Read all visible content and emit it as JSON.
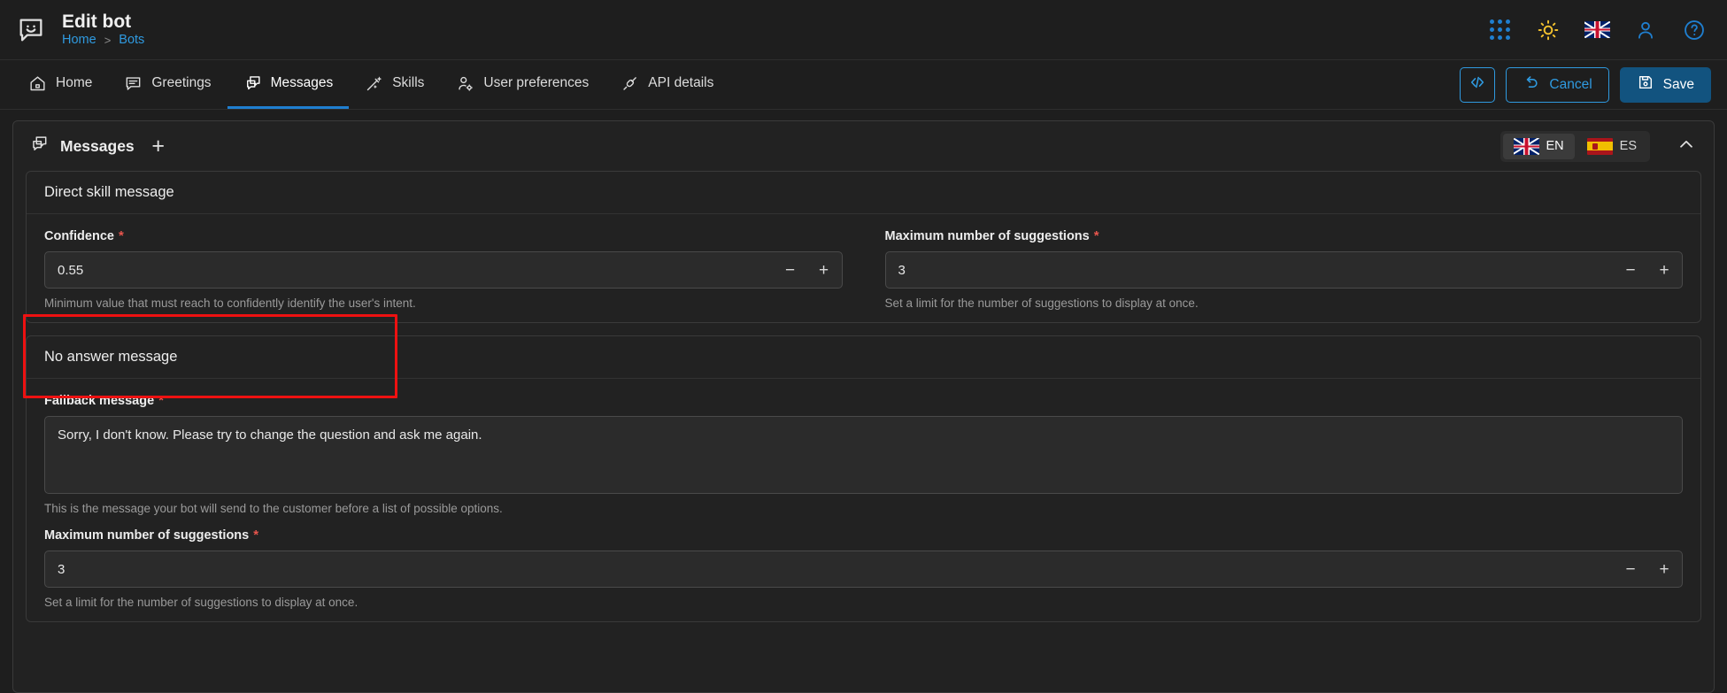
{
  "header": {
    "logo_icon": "chat-bubble-smiley-icon",
    "title": "Edit bot",
    "breadcrumb": {
      "home": "Home",
      "separator": ">",
      "current": "Bots"
    },
    "icons": [
      {
        "name": "apps-grid-icon",
        "label": "Apps"
      },
      {
        "name": "sun-theme-icon",
        "label": "Theme"
      },
      {
        "name": "uk-flag-icon",
        "label": "Language"
      },
      {
        "name": "user-account-icon",
        "label": "Account"
      },
      {
        "name": "help-question-icon",
        "label": "Help"
      }
    ],
    "accent_blue": "#1f7fd0",
    "link_blue": "#2f9ae0",
    "sun_yellow": "#f2c12e"
  },
  "nav": {
    "tabs": [
      {
        "label": "Home",
        "icon": "home-icon",
        "active": false
      },
      {
        "label": "Greetings",
        "icon": "speech-bubble-icon",
        "active": false
      },
      {
        "label": "Messages",
        "icon": "double-speech-bubble-icon",
        "active": true
      },
      {
        "label": "Skills",
        "icon": "magic-wand-icon",
        "active": false
      },
      {
        "label": "User preferences",
        "icon": "user-gear-icon",
        "active": false
      },
      {
        "label": "API details",
        "icon": "plug-connector-icon",
        "active": false
      }
    ],
    "actions": {
      "code_icon": "code-brackets-icon",
      "cancel_label": "Cancel",
      "cancel_icon": "undo-arrow-icon",
      "save_label": "Save",
      "save_icon": "floppy-disk-icon"
    }
  },
  "panel": {
    "title": "Messages",
    "title_icon": "double-speech-bubble-icon",
    "add_label": "+",
    "collapse_icon": "chevron-up-icon",
    "languages": [
      {
        "code": "EN",
        "flag": "uk-flag-icon",
        "selected": true
      },
      {
        "code": "ES",
        "flag": "spain-flag-icon",
        "selected": false
      }
    ]
  },
  "cards": [
    {
      "title": "Direct skill message",
      "fields": [
        {
          "label": "Confidence",
          "required": true,
          "value": "0.55",
          "helper": "Minimum value that must reach to confidently identify the user's intent.",
          "stepper": {
            "minus": "−",
            "plus": "+"
          },
          "highlighted": true
        },
        {
          "label": "Maximum number of suggestions",
          "required": true,
          "value": "3",
          "helper": "Set a limit for the number of suggestions to display at once.",
          "stepper": {
            "minus": "−",
            "plus": "+"
          },
          "highlighted": false
        }
      ]
    },
    {
      "title": "No answer message",
      "fields": [
        {
          "label": "Fallback message",
          "required": true,
          "value": "Sorry, I don't know. Please try to change the question and ask me again.",
          "helper": "This is the message your bot will send to the customer before a list of possible options."
        },
        {
          "label": "Maximum number of suggestions",
          "required": true,
          "value": "3",
          "helper": "Set a limit for the number of suggestions to display at once.",
          "stepper": {
            "minus": "−",
            "plus": "+"
          }
        }
      ]
    }
  ],
  "colors": {
    "background": "#1e1e1e",
    "panel": "#222222",
    "border": "#3a3a3a",
    "input_bg": "#2b2b2b",
    "highlight_red": "#ee1111",
    "required_red": "#e8554d"
  }
}
